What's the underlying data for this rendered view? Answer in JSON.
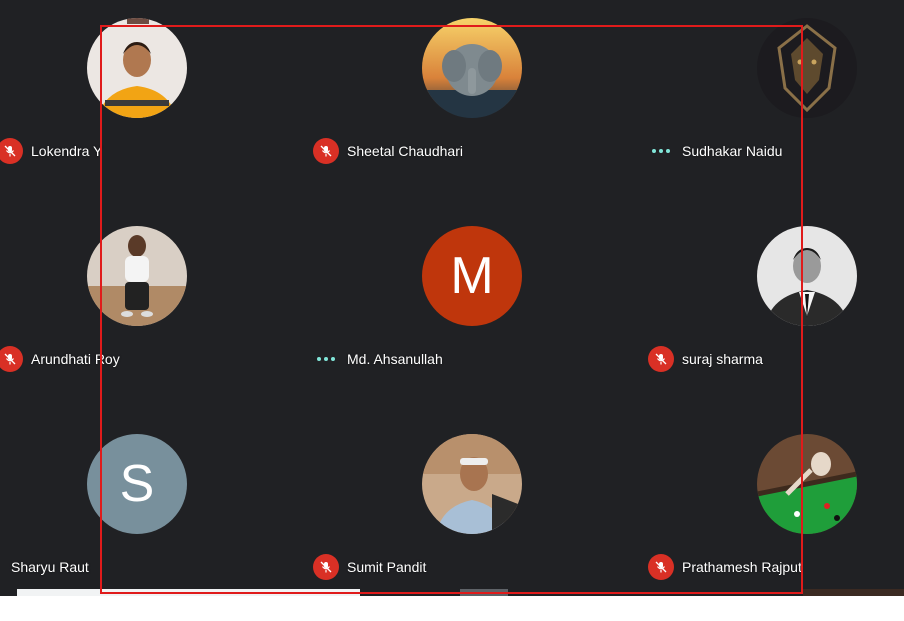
{
  "participants": [
    {
      "name": "Lokendra Y",
      "status": "muted",
      "avatar": "photo-man-yellow-shirt"
    },
    {
      "name": "Sheetal Chaudhari",
      "status": "muted",
      "avatar": "photo-ganesha-statue"
    },
    {
      "name": "Sudhakar Naidu",
      "status": "speaking",
      "avatar": "photo-gold-lion"
    },
    {
      "name": "Arundhati Roy",
      "status": "muted",
      "avatar": "photo-woman-sitting"
    },
    {
      "name": "Md. Ahsanullah",
      "status": "speaking",
      "avatar_letter": "M",
      "avatar_color": "#bf360c"
    },
    {
      "name": "suraj sharma",
      "status": "muted",
      "avatar": "photo-man-suit-bw"
    },
    {
      "name": "Sharyu Raut",
      "status": "none",
      "avatar_letter": "S",
      "avatar_color": "#78909c"
    },
    {
      "name": "Sumit Pandit",
      "status": "muted",
      "avatar": "photo-man-headband"
    },
    {
      "name": "Prathamesh Rajput",
      "status": "muted",
      "avatar": "photo-snooker-player"
    }
  ],
  "colors": {
    "background": "#202124",
    "mic_off": "#d93025",
    "speaking_dots": "#81e6d9",
    "selection_frame": "#e01b1b"
  }
}
